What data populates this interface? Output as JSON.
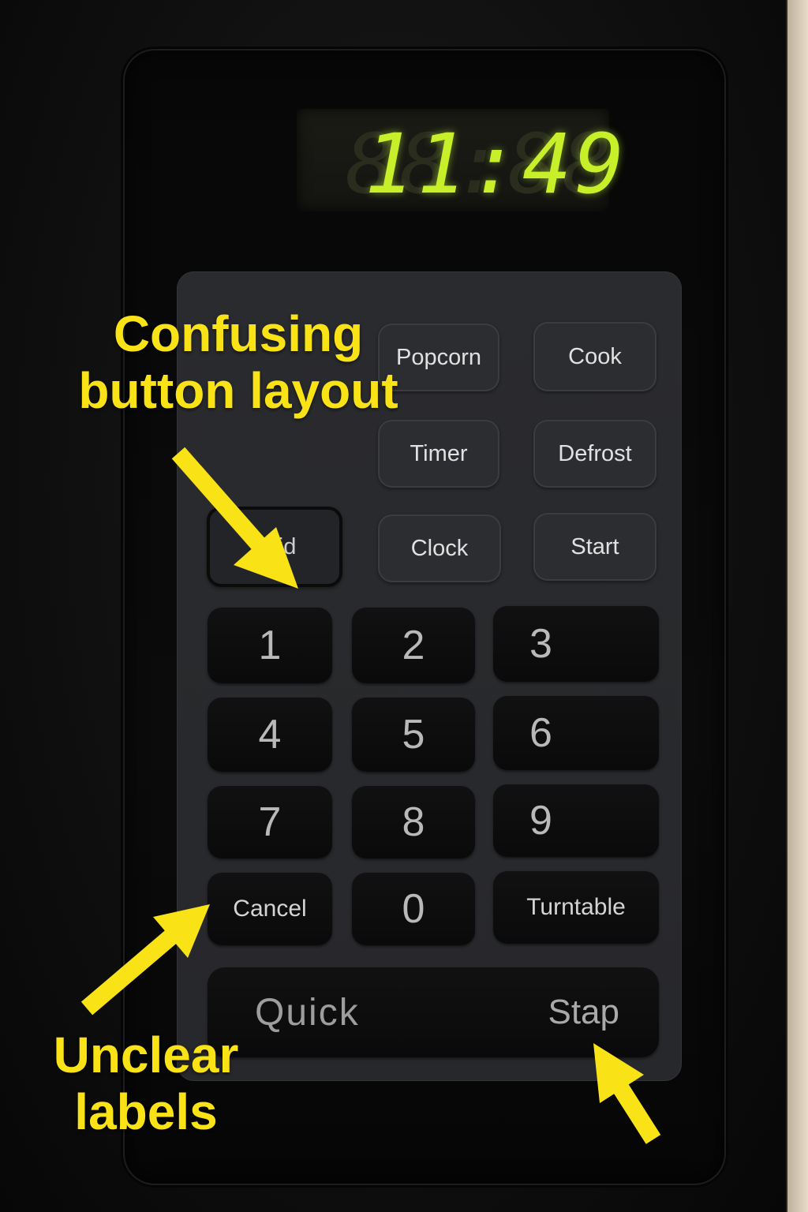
{
  "display": {
    "ghost": "88:88",
    "time": "11:49",
    "color": "#c7ef2a"
  },
  "buttons": {
    "popcorn": "Popcorn",
    "cook": "Cook",
    "timer": "Timer",
    "defrost": "Defrost",
    "hidden_label": "Grid",
    "clock": "Clock",
    "start": "Start",
    "digits": [
      "1",
      "2",
      "3",
      "4",
      "5",
      "6",
      "7",
      "8",
      "9",
      "0"
    ],
    "cancel": "Cancel",
    "turntable": "Turntable",
    "quick": "Quick",
    "stap": "Stap"
  },
  "annotations": {
    "layout_line1": "Confusing",
    "layout_line2": "button layout",
    "labels_line1": "Unclear",
    "labels_line2": "labels",
    "color": "#f9e316"
  }
}
